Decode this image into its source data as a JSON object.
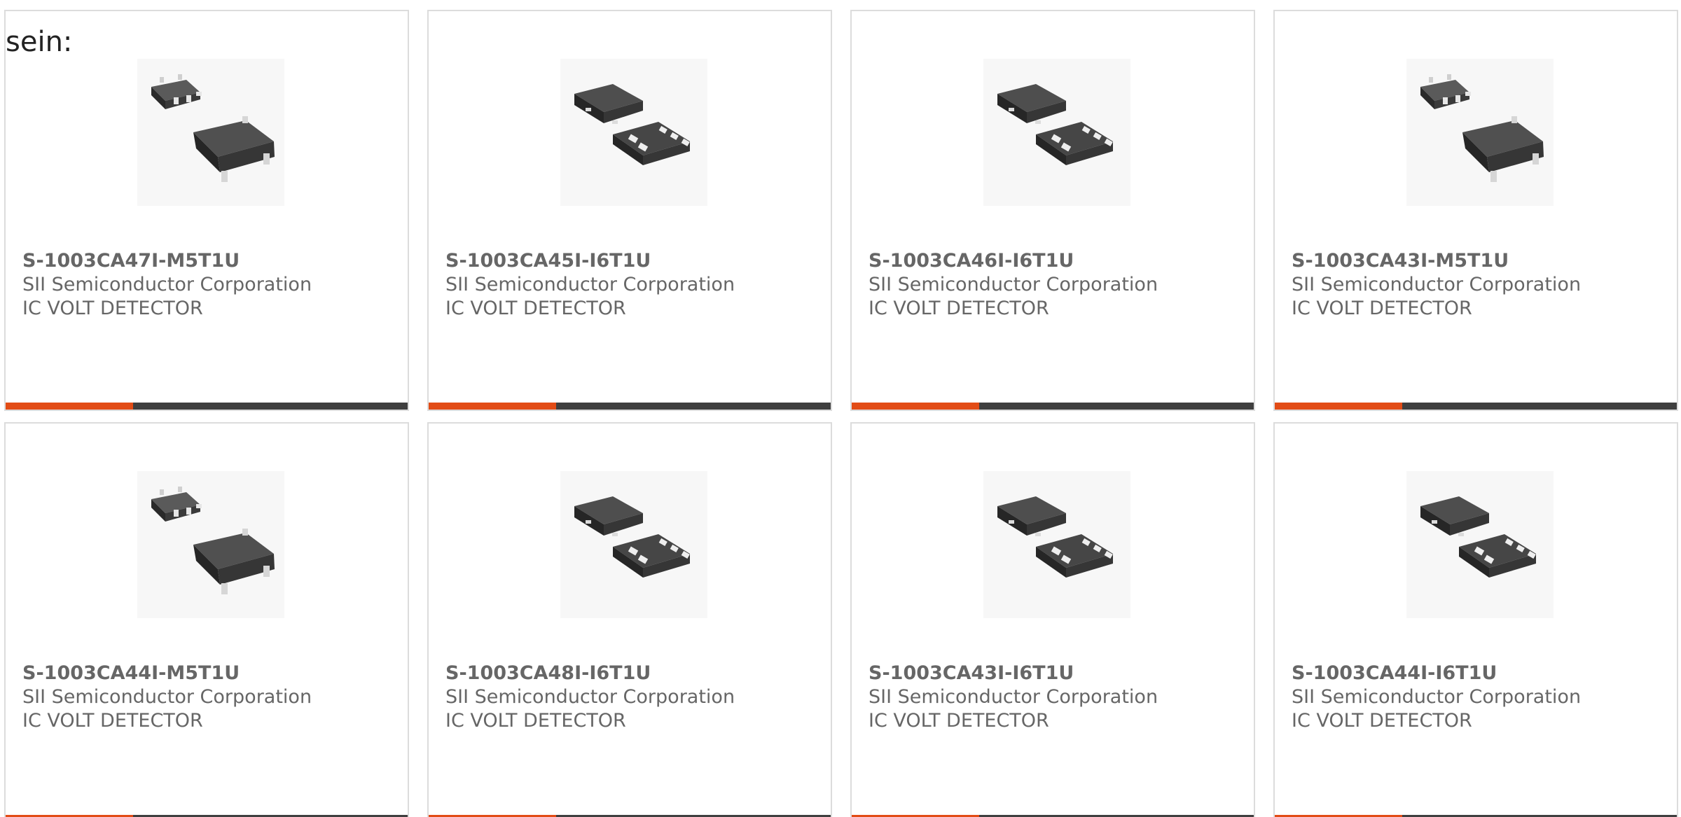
{
  "intro": {
    "text": "sein:"
  },
  "products": [
    {
      "part_number": "S-1003CA47I-M5T1U",
      "manufacturer": "SII Semiconductor Corporation",
      "description": "IC VOLT DETECTOR",
      "package_icon": "sot23-5-package-icon"
    },
    {
      "part_number": "S-1003CA45I-I6T1U",
      "manufacturer": "SII Semiconductor Corporation",
      "description": "IC VOLT DETECTOR",
      "package_icon": "snt-6-package-icon"
    },
    {
      "part_number": "S-1003CA46I-I6T1U",
      "manufacturer": "SII Semiconductor Corporation",
      "description": "IC VOLT DETECTOR",
      "package_icon": "snt-6-package-icon"
    },
    {
      "part_number": "S-1003CA43I-M5T1U",
      "manufacturer": "SII Semiconductor Corporation",
      "description": "IC VOLT DETECTOR",
      "package_icon": "sot23-5-package-icon"
    },
    {
      "part_number": "S-1003CA44I-M5T1U",
      "manufacturer": "SII Semiconductor Corporation",
      "description": "IC VOLT DETECTOR",
      "package_icon": "sot23-5-package-icon"
    },
    {
      "part_number": "S-1003CA48I-I6T1U",
      "manufacturer": "SII Semiconductor Corporation",
      "description": "IC VOLT DETECTOR",
      "package_icon": "snt-6-package-icon"
    },
    {
      "part_number": "S-1003CA43I-I6T1U",
      "manufacturer": "SII Semiconductor Corporation",
      "description": "IC VOLT DETECTOR",
      "package_icon": "snt-6-package-icon"
    },
    {
      "part_number": "S-1003CA44I-I6T1U",
      "manufacturer": "SII Semiconductor Corporation",
      "description": "IC VOLT DETECTOR",
      "package_icon": "snt-6-package-icon"
    }
  ],
  "colors": {
    "accent": "#e24c16",
    "bar": "#3f3f3f",
    "card_border": "#dcdcdc",
    "text": "#666666"
  }
}
